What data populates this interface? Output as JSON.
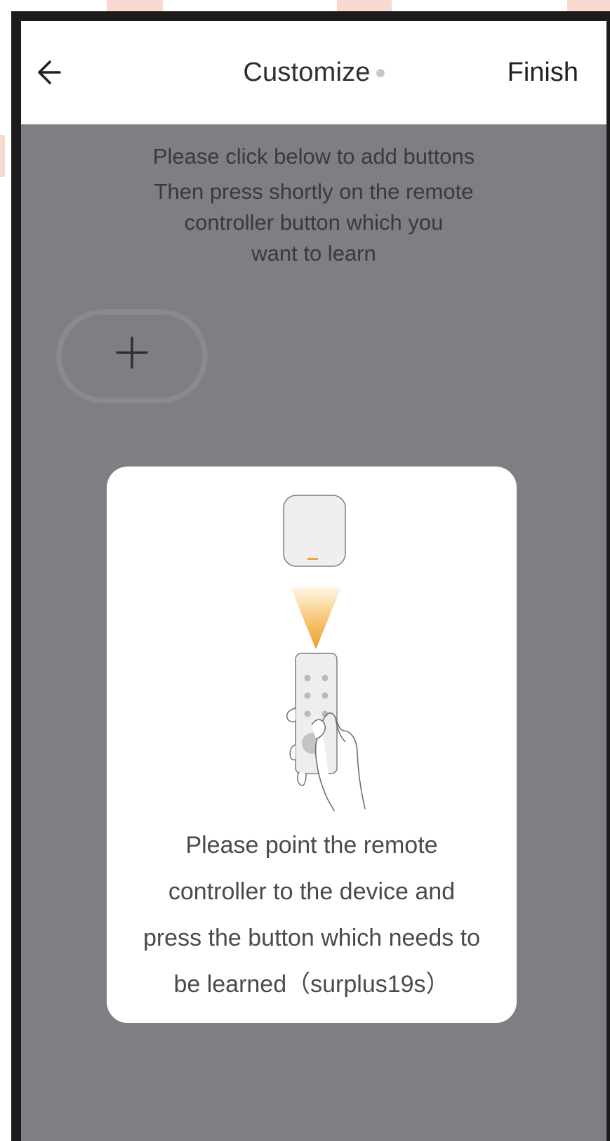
{
  "header": {
    "title": "Customize",
    "finish_label": "Finish",
    "back_icon": "arrow-left-icon"
  },
  "instructions": {
    "line1": "Please click below to add buttons",
    "line2": "Then press shortly on the remote",
    "line3": "controller button which you",
    "line4": "want to learn"
  },
  "add_button": {
    "icon": "plus-icon"
  },
  "dialog": {
    "illustration_icon": "remote-pointing-at-device-icon",
    "message_lines": [
      "Please point the remote",
      "controller to the device and",
      "press the button which needs to",
      "be learned（surplus19s）"
    ]
  },
  "colors": {
    "overlay_gray": "#7f7f83",
    "accent_orange": "#f0a63a",
    "frame_black": "#1c1c1c"
  }
}
